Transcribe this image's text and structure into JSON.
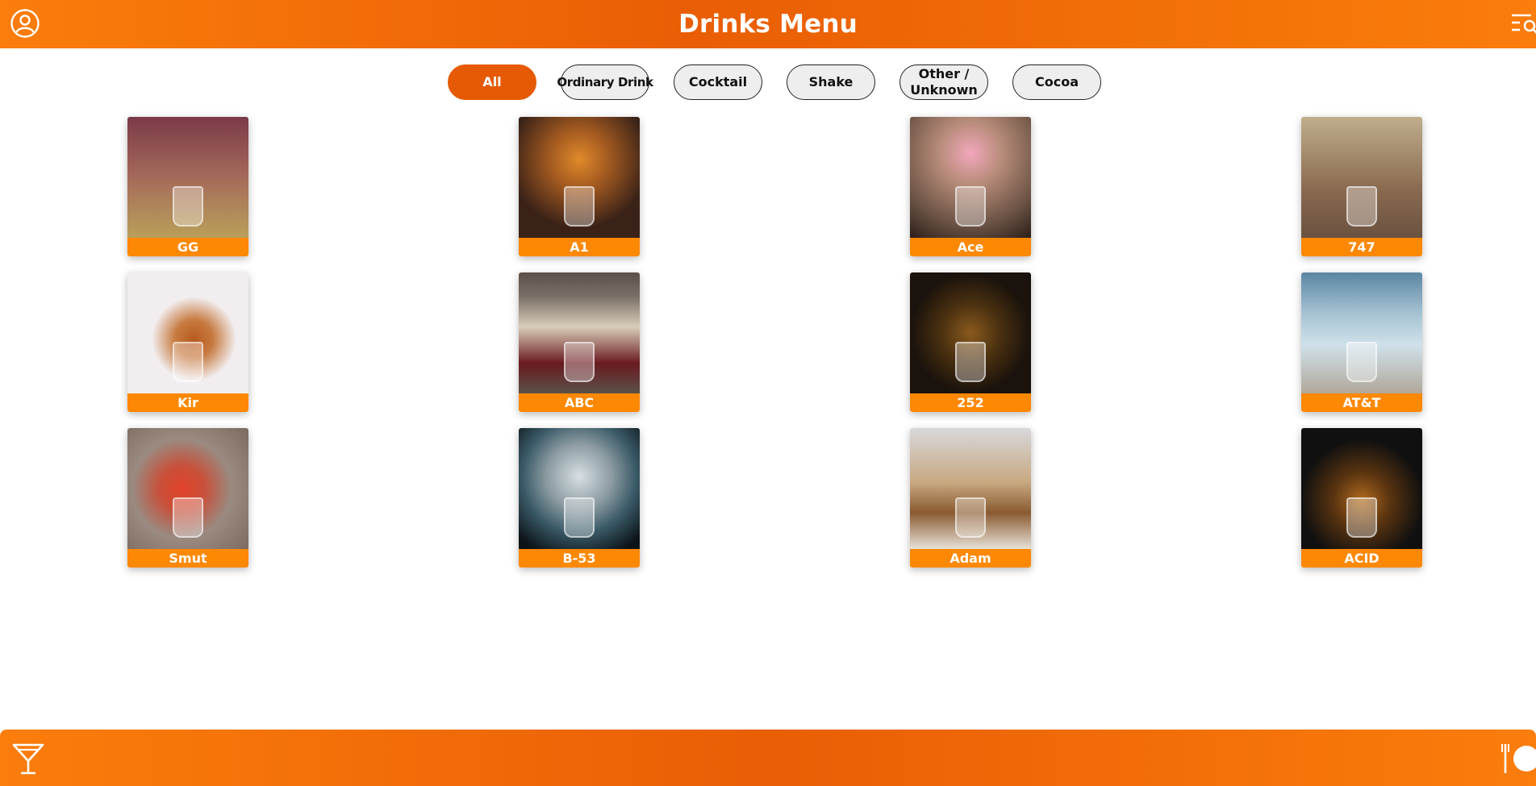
{
  "header": {
    "title": "Drinks Menu",
    "user_icon": "user-circle-icon",
    "menu_icon": "list-search-icon"
  },
  "filters": [
    {
      "label": "All",
      "active": true
    },
    {
      "label": "Ordinary Drink",
      "active": false
    },
    {
      "label": "Cocktail",
      "active": false
    },
    {
      "label": "Shake",
      "active": false
    },
    {
      "label": "Other / Unknown",
      "active": false
    },
    {
      "label": "Cocoa",
      "active": false
    }
  ],
  "drinks": [
    {
      "name": "GG",
      "color_a": "#b9a05a",
      "color_b": "#7a3a48"
    },
    {
      "name": "A1",
      "color_a": "#e08a2a",
      "color_b": "#3a2218"
    },
    {
      "name": "Ace",
      "color_a": "#f2a8bc",
      "color_b": "#6a5244"
    },
    {
      "name": "747",
      "color_a": "#8a6a50",
      "color_b": "#bfae8c"
    },
    {
      "name": "Kir",
      "color_a": "#b85a20",
      "color_b": "#f2eef0"
    },
    {
      "name": "ABC",
      "color_a": "#d8cdb8",
      "color_b": "#5a5048"
    },
    {
      "name": "252",
      "color_a": "#8a5a1e",
      "color_b": "#1a120c"
    },
    {
      "name": "AT&T",
      "color_a": "#cfe0ea",
      "color_b": "#5a86a2"
    },
    {
      "name": "Smut",
      "color_a": "#e2422a",
      "color_b": "#9a8a80"
    },
    {
      "name": "B-53",
      "color_a": "#3a5aa8",
      "color_b": "#0c1418"
    },
    {
      "name": "Adam",
      "color_a": "#8a5a30",
      "color_b": "#d8d8dc"
    },
    {
      "name": "ACID",
      "color_a": "#b06a1e",
      "color_b": "#101010"
    }
  ],
  "footer": {
    "left_icon": "cocktail-glass-icon",
    "right_icon": "plate-fork-icon"
  },
  "colors": {
    "brand_orange": "#f27008",
    "active_pill": "#e65a05",
    "label_orange": "#fd8804"
  }
}
